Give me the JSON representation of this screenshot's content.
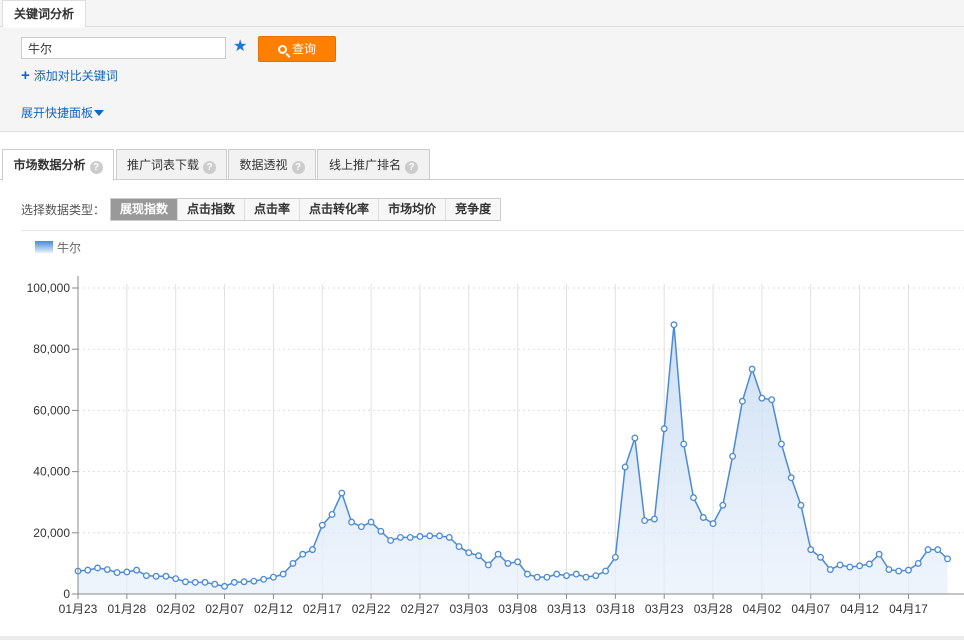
{
  "top_tab": {
    "label": "关键词分析"
  },
  "search": {
    "value": "牛尔",
    "query_label": "查询"
  },
  "add_compare_label": "添加对比关键词",
  "expand_panel_label": "展开快捷面板",
  "main_tabs": [
    {
      "label": "市场数据分析",
      "active": true
    },
    {
      "label": "推广词表下载",
      "active": false
    },
    {
      "label": "数据透视",
      "active": false
    },
    {
      "label": "线上推广排名",
      "active": false
    }
  ],
  "data_type": {
    "label": "选择数据类型：",
    "options": [
      "展现指数",
      "点击指数",
      "点击率",
      "点击转化率",
      "市场均价",
      "竞争度"
    ],
    "selected": "展现指数"
  },
  "colors": {
    "accent": "#ff7f00",
    "link": "#1565c0",
    "series": "#4a8ad8"
  },
  "chart_data": {
    "type": "area",
    "legend": [
      "牛尔"
    ],
    "series": [
      {
        "name": "牛尔",
        "values": [
          7500,
          7800,
          8500,
          8000,
          7000,
          7200,
          7800,
          6000,
          5800,
          5800,
          5000,
          4000,
          3800,
          3800,
          3200,
          2500,
          3800,
          4000,
          4200,
          4800,
          5500,
          6500,
          10000,
          13000,
          14500,
          22500,
          26000,
          33000,
          23500,
          22000,
          23500,
          20500,
          17500,
          18500,
          18500,
          18800,
          19000,
          19000,
          18500,
          15500,
          13500,
          12500,
          9500,
          13000,
          10000,
          10500,
          6500,
          5500,
          5500,
          6500,
          6000,
          6500,
          5500,
          6000,
          7500,
          12000,
          41500,
          51000,
          24000,
          24500,
          54000,
          88000,
          49000,
          31500,
          25000,
          23000,
          29000,
          45000,
          63000,
          73500,
          64000,
          63500,
          49000,
          38000,
          29000,
          14500,
          12000,
          8000,
          9500,
          8800,
          9200,
          9800,
          13000,
          8000,
          7500,
          7800,
          10000,
          14500,
          14500,
          11500
        ]
      }
    ],
    "x_tick_labels": [
      "01月23",
      "01月28",
      "02月02",
      "02月07",
      "02月12",
      "02月17",
      "02月22",
      "02月27",
      "03月03",
      "03月08",
      "03月13",
      "03月18",
      "03月23",
      "03月28",
      "04月02",
      "04月07",
      "04月12",
      "04月17"
    ],
    "y_tick_labels": [
      "0",
      "20,000",
      "40,000",
      "60,000",
      "80,000",
      "100,000"
    ],
    "ylim": [
      0,
      100000
    ],
    "grid": true
  }
}
